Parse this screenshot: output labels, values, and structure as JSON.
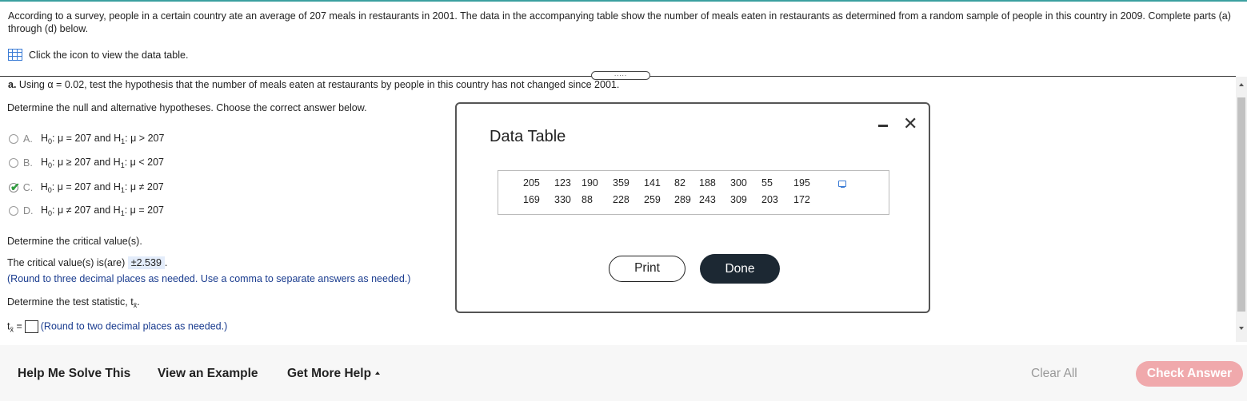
{
  "problem_text": "According to a survey, people in a certain country ate an average of 207 meals in restaurants in 2001. The data in the accompanying table show the number of meals eaten in restaurants as determined from a random sample of people in this country in 2009. Complete parts (a) through (d) below.",
  "data_link": "Click the icon to view the data table.",
  "part_a": {
    "label": "a.",
    "text": "Using α = 0.02, test the hypothesis that the number of meals eaten at restaurants by people in this country has not changed since 2001."
  },
  "q1": "Determine the null and alternative hypotheses. Choose the correct answer below.",
  "options": [
    {
      "letter": "A.",
      "h0_rel": "= 207",
      "h1_rel": "> 207",
      "selected": false
    },
    {
      "letter": "B.",
      "h0_rel": "≥ 207",
      "h1_rel": "< 207",
      "selected": false
    },
    {
      "letter": "C.",
      "h0_rel": "= 207",
      "h1_rel": "≠ 207",
      "selected": true
    },
    {
      "letter": "D.",
      "h0_rel": "≠ 207",
      "h1_rel": "= 207",
      "selected": false
    }
  ],
  "q2": "Determine the critical value(s).",
  "critical_prompt": "The critical value(s) is(are)",
  "critical_value": "±2.539",
  "critical_hint": "(Round to three decimal places as needed. Use a comma to separate answers as needed.)",
  "q3": "Determine the test statistic, t",
  "t_hint": "(Round to two decimal places as needed.)",
  "footer": {
    "help": "Help Me Solve This",
    "example": "View an Example",
    "more_help": "Get More Help",
    "clear": "Clear All",
    "check": "Check Answer"
  },
  "dialog": {
    "title": "Data Table",
    "row1": [
      "205",
      "123",
      "190",
      "359",
      "141",
      "82",
      "188",
      "300",
      "55",
      "195"
    ],
    "row2": [
      "169",
      "330",
      "88",
      "228",
      "259",
      "289",
      "243",
      "309",
      "203",
      "172"
    ],
    "print": "Print",
    "done": "Done"
  },
  "colors": {
    "accent": "#3a7bd5",
    "check_green": "#2e9b3d",
    "check_answer_bg": "#f0a9ac",
    "done_bg": "#1c2833",
    "answer_highlight": "#e3ecfa"
  }
}
